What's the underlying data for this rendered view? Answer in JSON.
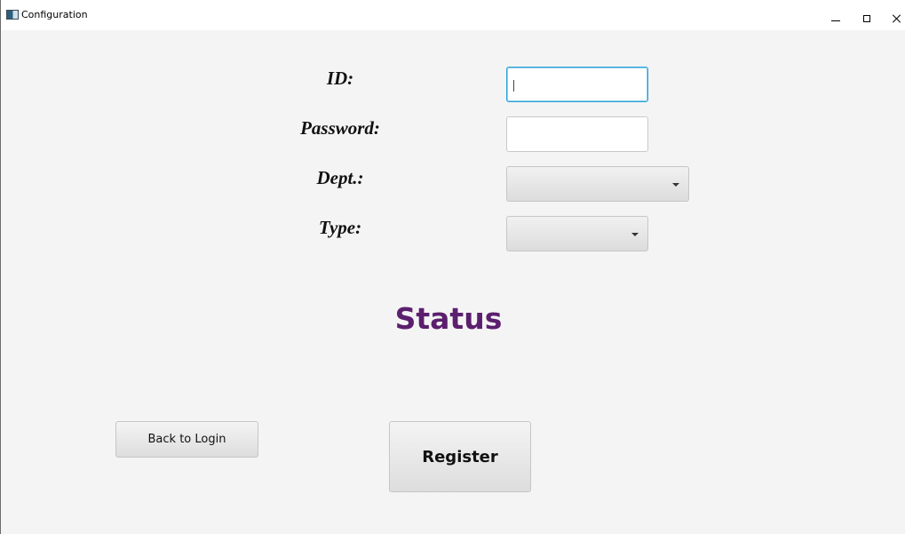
{
  "window": {
    "title": "Configuration",
    "icon": "app-window-icon",
    "controls": {
      "minimize": "minimize-icon",
      "maximize": "maximize-icon",
      "close": "close-icon"
    }
  },
  "form": {
    "id_label": "ID:",
    "id_value": "",
    "password_label": "Password:",
    "password_value": "",
    "dept_label": "Dept.:",
    "dept_selected": "",
    "type_label": "Type:",
    "type_selected": ""
  },
  "status": {
    "text": "Status",
    "color": "#5b1f6e"
  },
  "buttons": {
    "back_label": "Back to Login",
    "register_label": "Register"
  },
  "colors": {
    "focus_border": "#2a9fd8",
    "background": "#f4f4f4"
  }
}
